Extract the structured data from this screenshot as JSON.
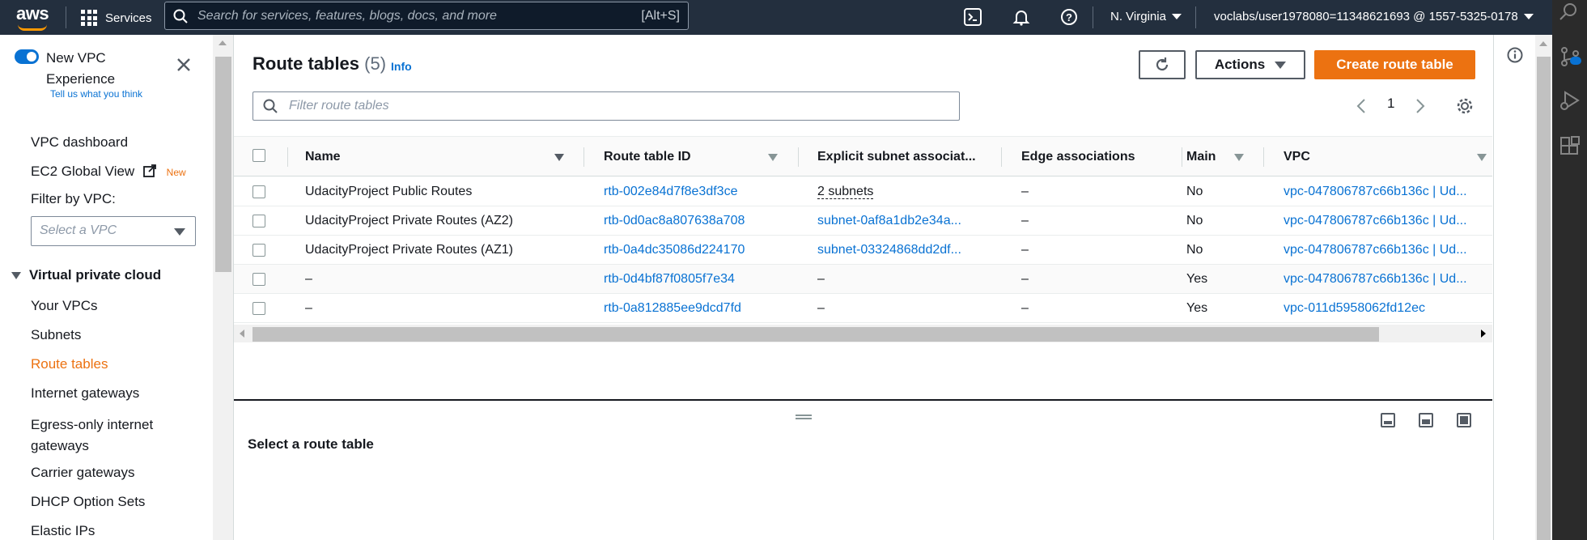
{
  "nav": {
    "logo": "aws",
    "services": "Services",
    "search_placeholder": "Search for services, features, blogs, docs, and more",
    "search_shortcut": "[Alt+S]",
    "region": "N. Virginia",
    "account": "voclabs/user1978080=11348621693 @ 1557-5325-0178",
    "icons": [
      "cloudshell-icon",
      "bell-icon",
      "help-icon"
    ]
  },
  "sidebar": {
    "toggle_label": "New VPC Experience",
    "feedback": "Tell us what you think",
    "dashboard": "VPC dashboard",
    "ec2_global": "EC2 Global View",
    "new_badge": "New",
    "filter_label": "Filter by VPC:",
    "filter_placeholder": "Select a VPC",
    "section": "Virtual private cloud",
    "items": [
      "Your VPCs",
      "Subnets",
      "Route tables",
      "Internet gateways",
      "Egress-only internet gateways",
      "Carrier gateways",
      "DHCP Option Sets",
      "Elastic IPs"
    ],
    "active_item": "Route tables"
  },
  "main": {
    "title": "Route tables",
    "count": "(5)",
    "info": "Info",
    "actions": "Actions",
    "create": "Create route table",
    "filter_placeholder": "Filter route tables",
    "page": "1",
    "columns": [
      "Name",
      "Route table ID",
      "Explicit subnet associat...",
      "Edge associations",
      "Main",
      "VPC"
    ],
    "rows": [
      {
        "name": "UdacityProject Public Routes",
        "id": "rtb-002e84d7f8e3df3ce",
        "subnet": "2 subnets",
        "edge": "–",
        "main": "No",
        "vpc": "vpc-047806787c66b136c | Ud..."
      },
      {
        "name": "UdacityProject Private Routes (AZ2)",
        "id": "rtb-0d0ac8a807638a708",
        "subnet": "subnet-0af8a1db2e34a...",
        "edge": "–",
        "main": "No",
        "vpc": "vpc-047806787c66b136c | Ud..."
      },
      {
        "name": "UdacityProject Private Routes (AZ1)",
        "id": "rtb-0a4dc35086d224170",
        "subnet": "subnet-03324868dd2df...",
        "edge": "–",
        "main": "No",
        "vpc": "vpc-047806787c66b136c | Ud..."
      },
      {
        "name": "–",
        "id": "rtb-0d4bf87f0805f7e34",
        "subnet": "–",
        "edge": "–",
        "main": "Yes",
        "vpc": "vpc-047806787c66b136c | Ud..."
      },
      {
        "name": "–",
        "id": "rtb-0a812885ee9dcd7fd",
        "subnet": "–",
        "edge": "–",
        "main": "Yes",
        "vpc": "vpc-011d5958062fd12ec"
      }
    ],
    "split_title": "Select a route table"
  },
  "colors": {
    "nav_bg": "#232f3e",
    "accent": "#ec7211",
    "link": "#0972d3"
  }
}
